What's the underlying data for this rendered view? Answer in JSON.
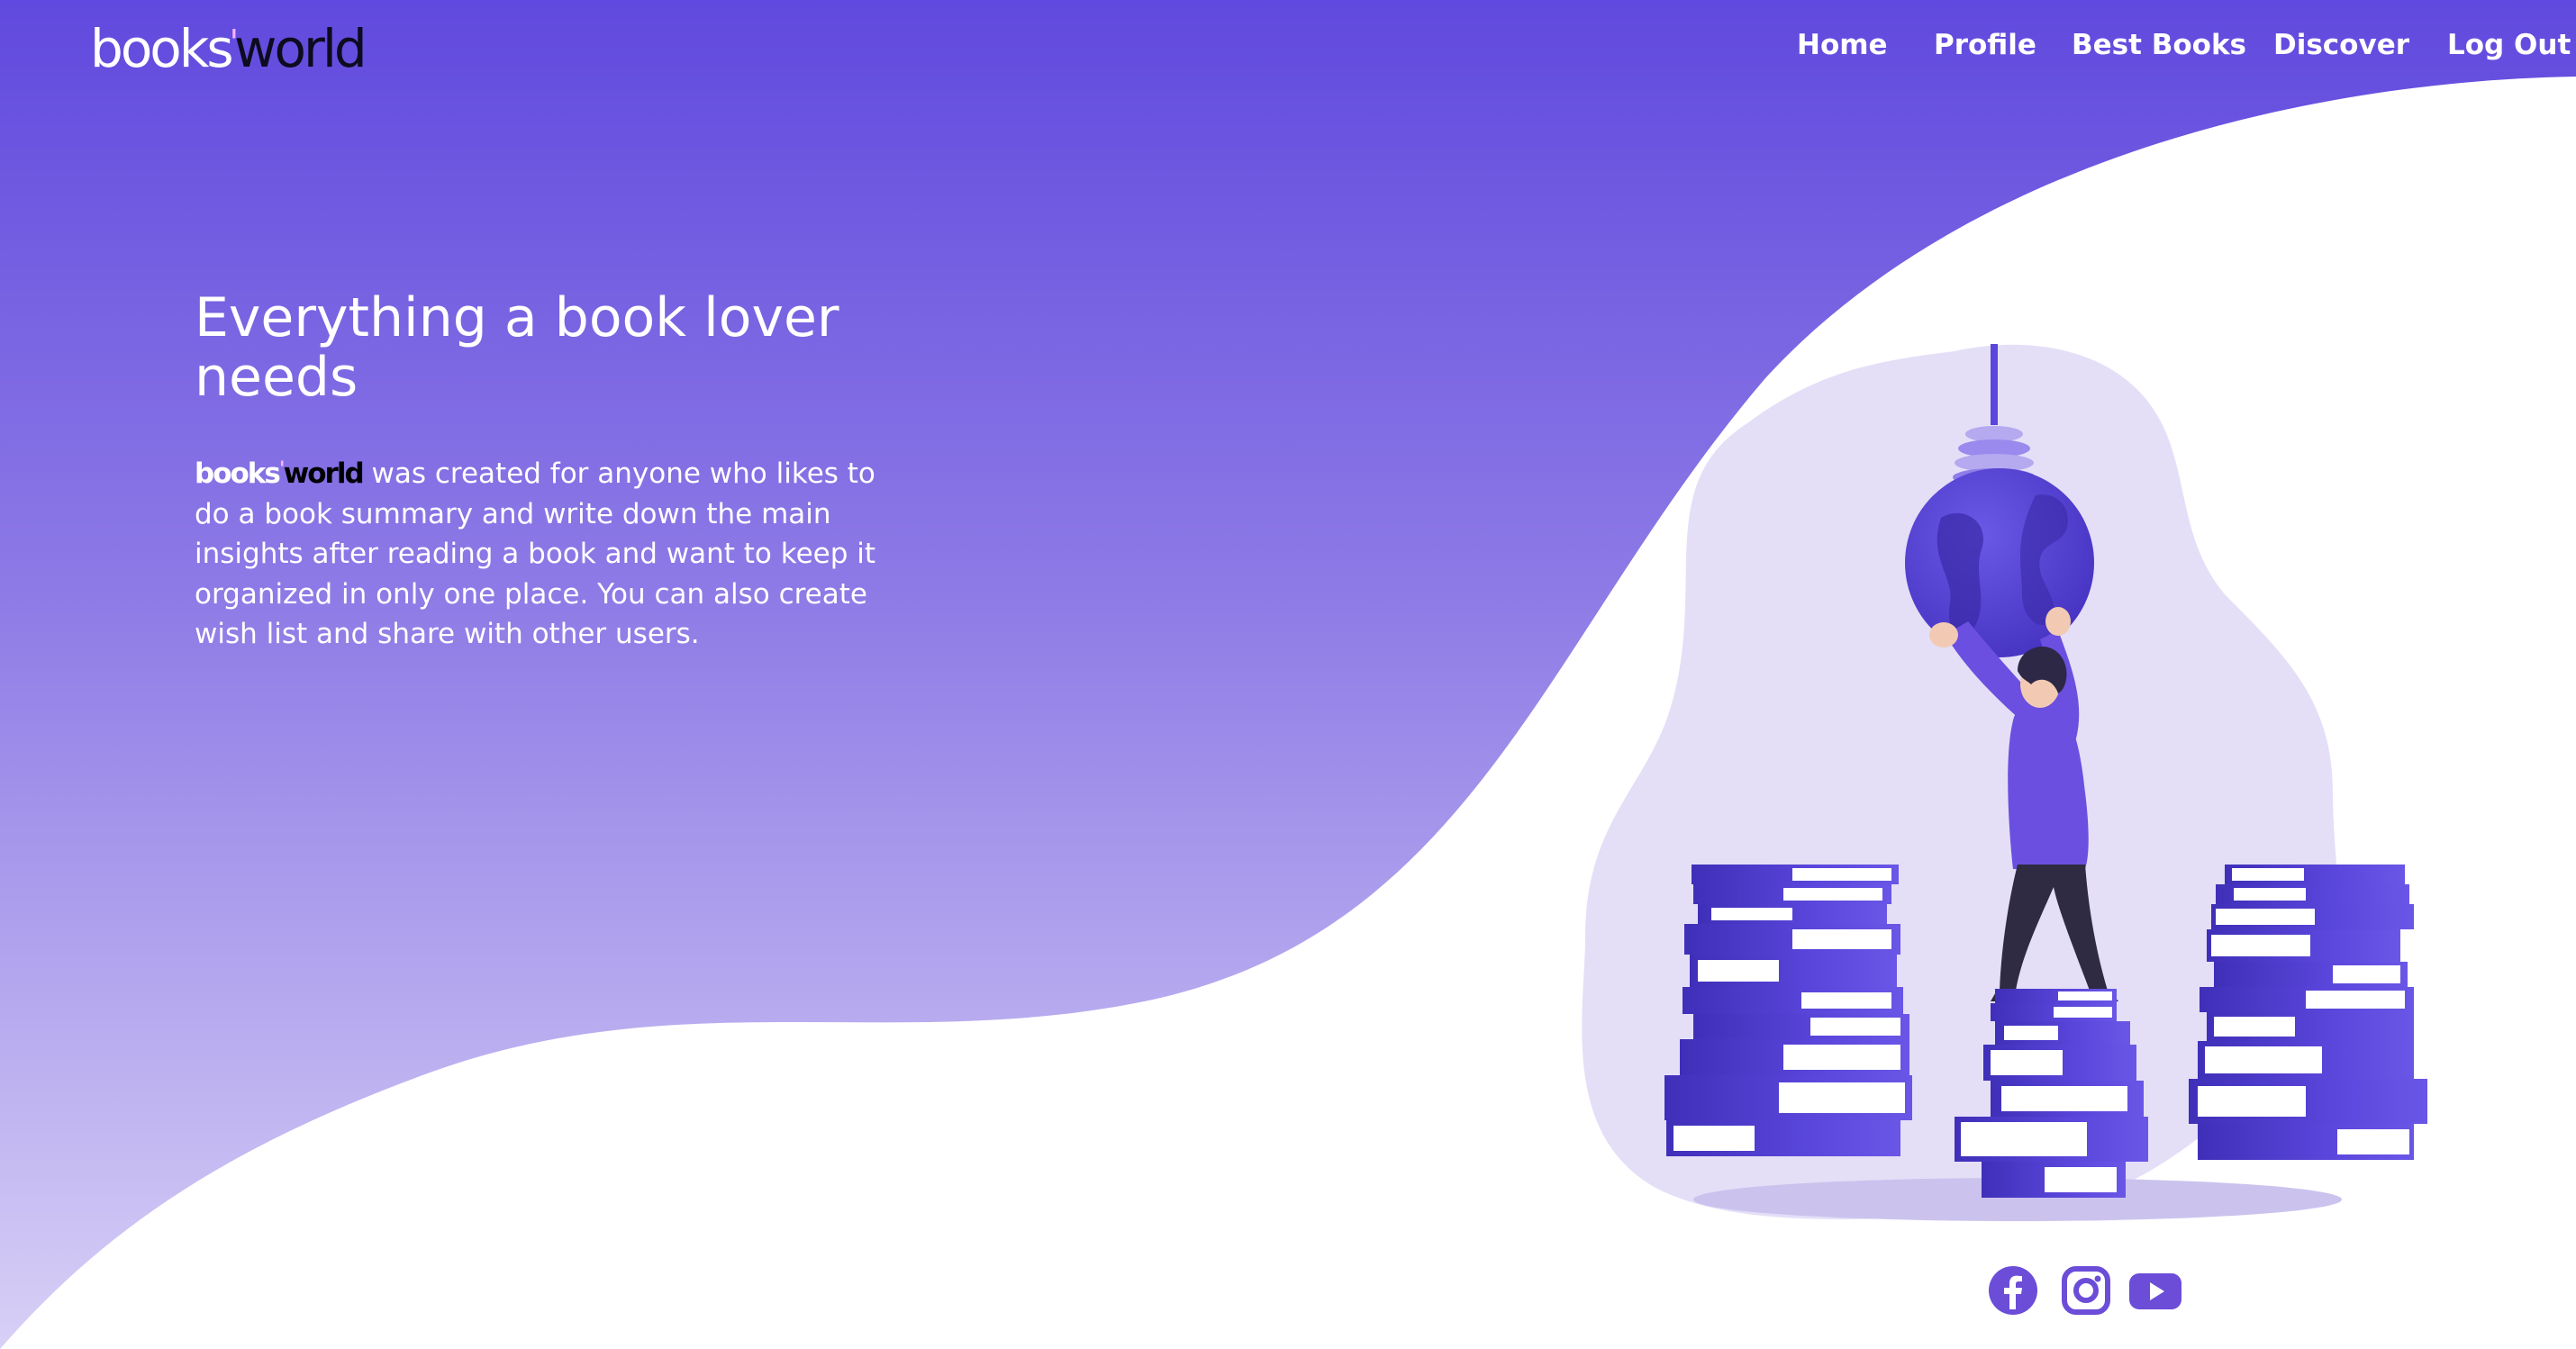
{
  "brand": {
    "logo_part1": "books",
    "logo_part2": "'",
    "logo_part3": "world"
  },
  "nav": {
    "items": [
      {
        "label": "Home"
      },
      {
        "label": "Profile"
      },
      {
        "label": "Best Books"
      },
      {
        "label": "Discover"
      },
      {
        "label": "Log Out"
      }
    ]
  },
  "hero": {
    "title": "Everything a book lover needs",
    "description_brand_part1": "books",
    "description_brand_part2": "'",
    "description_brand_part3": "world",
    "description_text": " was created for anyone who likes to do a book summary and write down the main insights after reading a book and want to keep it organized in only one place. You can also create wish list and share with other users."
  },
  "socials": [
    {
      "icon": "facebook-icon"
    },
    {
      "icon": "instagram-icon"
    },
    {
      "icon": "youtube-icon"
    }
  ],
  "colors": {
    "primary": "#6049de",
    "gradient_top": "#6049de",
    "gradient_bottom": "#d8d0f6",
    "blob": "#e4dff7",
    "accent_pink": "#f6b3ff",
    "social": "#6b4dd8"
  }
}
